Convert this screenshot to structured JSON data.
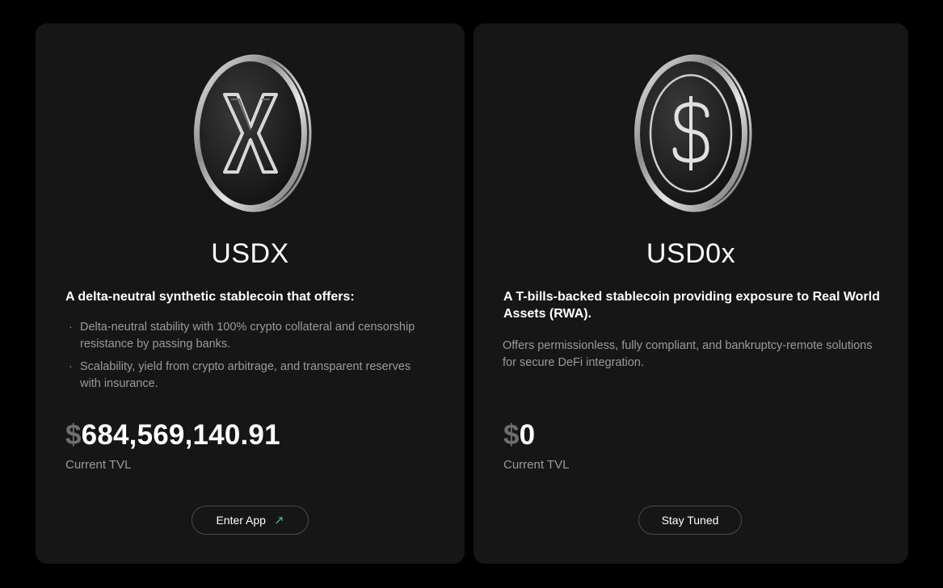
{
  "cards": [
    {
      "title": "USDX",
      "subtitle": "A delta-neutral synthetic stablecoin that offers:",
      "bullets": [
        "Delta-neutral stability with 100% crypto collateral and censorship resistance by passing banks.",
        "Scalability, yield from crypto arbitrage, and transparent reserves with insurance."
      ],
      "currency": "$",
      "tvl": "684,569,140.91",
      "tvl_label": "Current TVL",
      "button_label": "Enter App",
      "button_icon": "arrow-up-right-icon",
      "coin_icon": "x-coin-icon"
    },
    {
      "title": "USD0x",
      "subtitle": "A T-bills-backed stablecoin providing exposure to Real World Assets (RWA).",
      "description": "Offers permissionless, fully compliant, and bankruptcy-remote solutions for secure DeFi integration.",
      "currency": "$",
      "tvl": "0",
      "tvl_label": "Current TVL",
      "button_label": "Stay Tuned",
      "coin_icon": "dollar-coin-icon"
    }
  ],
  "colors": {
    "background": "#000000",
    "card": "#161616",
    "accent_arrow": "#3fc38a",
    "muted_text": "#9a9a9a"
  }
}
